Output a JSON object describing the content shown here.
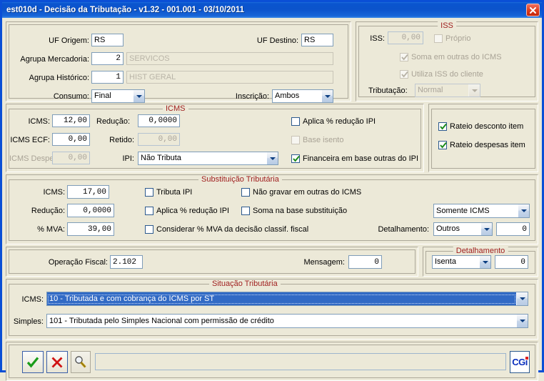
{
  "window": {
    "title": "est010d - Decisão da Tributação - v1.32 - 001.001 - 03/10/2011",
    "close_label": "Fechar",
    "colors": {
      "titlebar": "#0b53cb",
      "face": "#ece9d8",
      "legend": "#a02020",
      "selection": "#316ac5"
    }
  },
  "header": {
    "uf_origem_label": "UF Origem:",
    "uf_origem_value": "RS",
    "uf_destino_label": "UF Destino:",
    "uf_destino_value": "RS",
    "agrupa_mercadoria_label": "Agrupa Mercadoria:",
    "agrupa_mercadoria_value": "2",
    "agrupa_mercadoria_desc": "SERVICOS",
    "agrupa_historico_label": "Agrupa Histórico:",
    "agrupa_historico_value": "1",
    "agrupa_historico_desc": "HIST GERAL",
    "consumo_label": "Consumo:",
    "consumo_value": "Final",
    "inscricao_label": "Inscrição:",
    "inscricao_value": "Ambos"
  },
  "iss": {
    "legend": "ISS",
    "iss_label": "ISS:",
    "iss_value": "0,00",
    "proprio_label": "Próprio",
    "proprio_checked": false,
    "soma_outras_label": "Soma em outras do ICMS",
    "soma_outras_checked": true,
    "utiliza_iss_label": "Utiliza ISS do cliente",
    "utiliza_iss_checked": true,
    "tributacao_label": "Tributação:",
    "tributacao_value": "Normal"
  },
  "icms": {
    "legend": "ICMS",
    "icms_label": "ICMS:",
    "icms_value": "12,00",
    "reducao_label": "Redução:",
    "reducao_value": "0,0000",
    "icms_ecf_label": "ICMS ECF:",
    "icms_ecf_value": "0,00",
    "retido_label": "Retido:",
    "retido_value": "0,00",
    "icms_despesa_label": "ICMS Despesa:",
    "icms_despesa_value": "0,00",
    "ipi_label": "IPI:",
    "ipi_value": "Não Tributa",
    "aplica_reducao_ipi_label": "Aplica % redução IPI",
    "aplica_reducao_ipi_checked": false,
    "base_isento_label": "Base isento",
    "base_isento_checked": false,
    "financeira_label": "Financeira em base outras do IPI",
    "financeira_checked": true
  },
  "rateio": {
    "desconto_label": "Rateio desconto item",
    "desconto_checked": true,
    "despesas_label": "Rateio despesas item",
    "despesas_checked": true
  },
  "substituicao": {
    "legend": "Substituição Tributária",
    "icms_label": "ICMS:",
    "icms_value": "17,00",
    "reducao_label": "Redução:",
    "reducao_value": "0,0000",
    "mva_label": "% MVA:",
    "mva_value": "39,00",
    "tributa_ipi_label": "Tributa IPI",
    "tributa_ipi_checked": false,
    "aplica_reducao_ipi_label": "Aplica % redução IPI",
    "aplica_reducao_ipi_checked": false,
    "considerar_mva_label": "Considerar % MVA da decisão classif. fiscal",
    "considerar_mva_checked": false,
    "nao_gravar_label": "Não gravar em outras do ICMS",
    "nao_gravar_checked": false,
    "soma_base_label": "Soma na base substituição",
    "soma_base_checked": false,
    "somente_icms_value": "Somente ICMS",
    "detalhamento_label": "Detalhamento:",
    "detalhamento_value": "Outros",
    "detalhamento_number": "0"
  },
  "operacao": {
    "operacao_fiscal_label": "Operação Fiscal:",
    "operacao_fiscal_value": "2.102",
    "mensagem_label": "Mensagem:",
    "mensagem_value": "0"
  },
  "detalhamento_box": {
    "legend": "Detalhamento",
    "select_value": "Isenta",
    "number_value": "0"
  },
  "situacao": {
    "legend": "Situação Tributária",
    "icms_label": "ICMS:",
    "icms_value": "10 - Tributada e com cobrança do ICMS por ST",
    "simples_label": "Simples:",
    "simples_value": "101 - Tributada pelo Simples Nacional com permissão de crédito"
  },
  "toolbar": {
    "confirm_label": "Confirmar",
    "cancel_label": "Cancelar",
    "search_label": "Pesquisar",
    "status_value": "",
    "brand_label": "CGi"
  }
}
